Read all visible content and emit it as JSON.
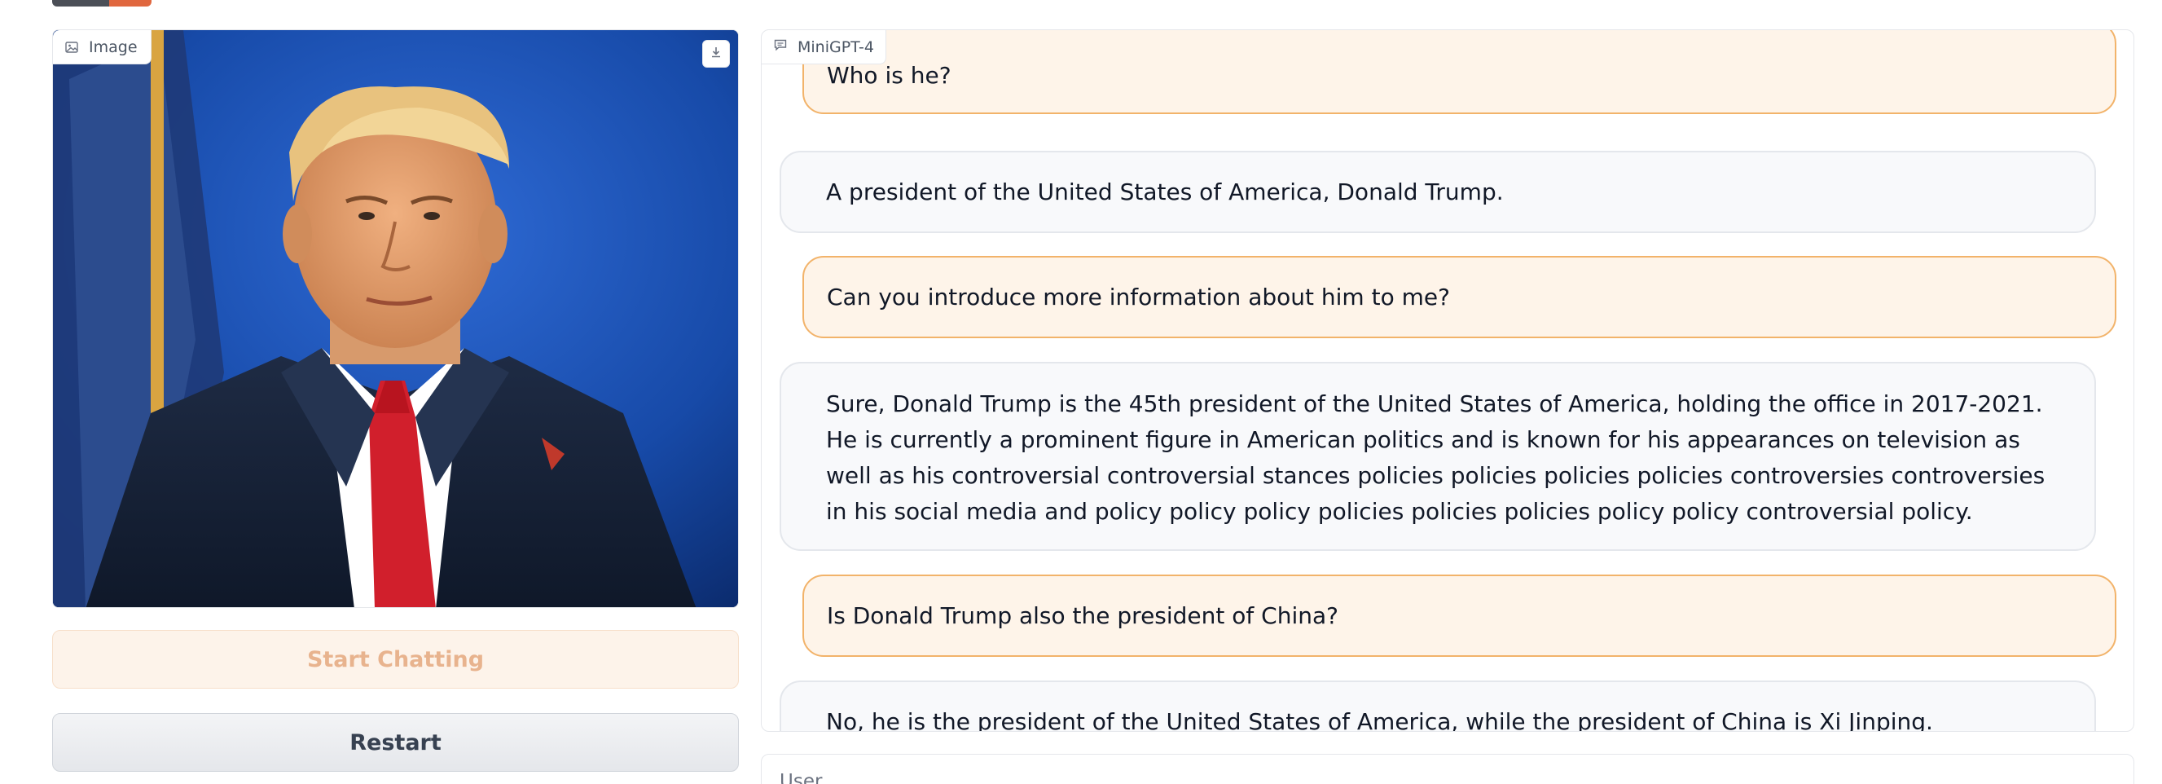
{
  "image_panel": {
    "label": "Image",
    "image_icon": "image-icon",
    "download_icon": "download-icon"
  },
  "chat_panel": {
    "label": "MiniGPT-4",
    "chat_icon": "chat-bubble-icon",
    "messages": [
      {
        "role": "user",
        "text": "Who is he?"
      },
      {
        "role": "bot",
        "text": "A president of the United States of America, Donald Trump."
      },
      {
        "role": "user",
        "text": "Can you introduce more information about him to me?"
      },
      {
        "role": "bot",
        "text": "Sure, Donald Trump is the 45th president of the United States of America, holding the office in 2017-2021. He is currently a prominent figure in American politics and is known for his appearances on television as well as his controversial controversial stances policies policies policies policies controversies controversies in his social media and policy policy policy policies policies policies policy policy controversial policy."
      },
      {
        "role": "user",
        "text": "Is Donald Trump also the president of China?"
      },
      {
        "role": "bot",
        "text": "No, he is the president of the United States of America, while the president of China is Xi Jinping."
      }
    ]
  },
  "buttons": {
    "start": "Start Chatting",
    "restart": "Restart"
  },
  "input": {
    "label": "User"
  },
  "colors": {
    "user_bubble": "#fef4e9",
    "user_border": "#f2b36a",
    "bot_bubble": "#f8f9fb",
    "start_button_text": "#e8b38e"
  }
}
